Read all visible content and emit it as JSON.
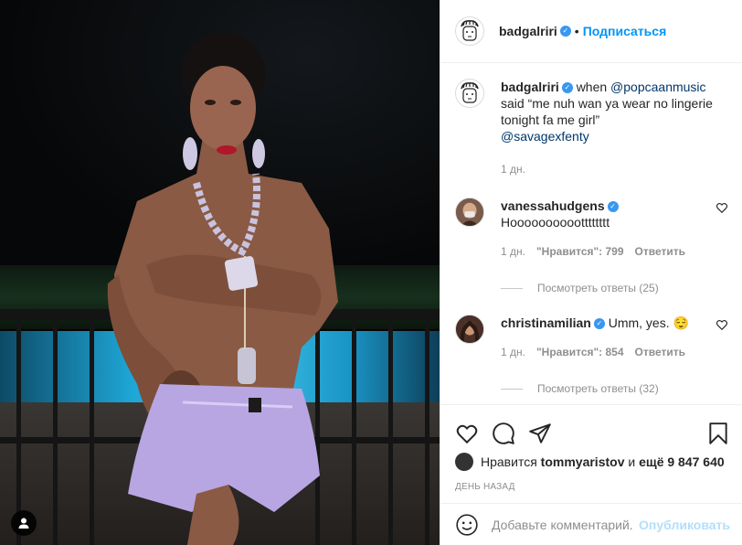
{
  "post": {
    "author": "badgalriri",
    "follow_label": "Подписаться",
    "separator": "•"
  },
  "caption": {
    "author": "badgalriri",
    "text_lead": "when",
    "mention_1": "@popcaanmusic",
    "text_rest": "said “me nuh wan ya wear no lingerie tonight fa me girl”",
    "mention_2": "@savagexfenty",
    "time": "1 дн."
  },
  "comments": [
    {
      "author": "vanessahudgens",
      "text": "Hooooooooootttttttt",
      "time": "1 дн.",
      "likes": "\"Нравится\": 799",
      "reply_label": "Ответить",
      "view_replies": "Посмотреть ответы (25)"
    },
    {
      "author": "christinamilian",
      "text": "Umm, yes. 😌",
      "time": "1 дн.",
      "likes": "\"Нравится\": 854",
      "reply_label": "Ответить",
      "view_replies": "Посмотреть ответы (32)"
    }
  ],
  "actions": {
    "icons": [
      "heart-icon",
      "comment-icon",
      "share-icon",
      "bookmark-icon"
    ]
  },
  "likes": {
    "prefix": "Нравится",
    "user": "tommyaristov",
    "conj": "и",
    "count": "ещё 9 847 640"
  },
  "date": "ДЕНЬ НАЗАД",
  "add_comment": {
    "placeholder": "Добавьте комментарий...",
    "publish_label": "Опубликовать"
  },
  "colors": {
    "accent": "#0095f6",
    "verified": "#3897f0",
    "muted": "#8e8e8e"
  }
}
